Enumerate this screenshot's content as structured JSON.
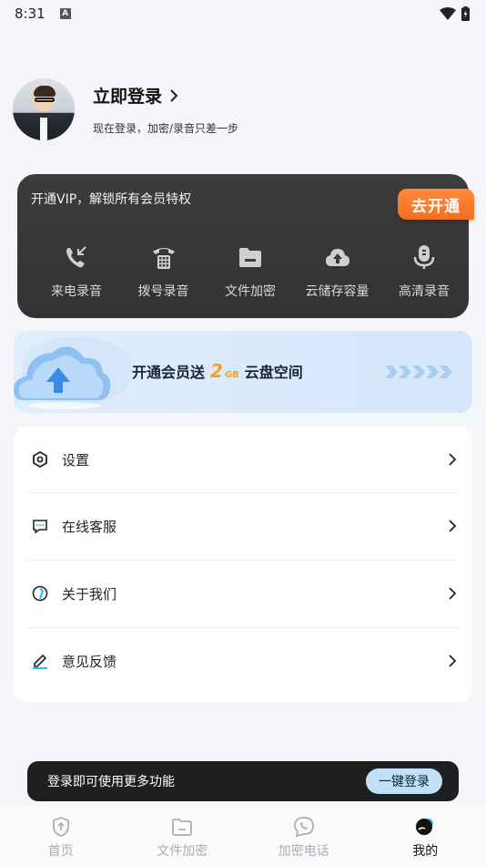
{
  "status_bar": {
    "time": "8:31",
    "notification_badge": "A"
  },
  "profile": {
    "title": "立即登录",
    "subtitle": "现在登录，加密/录音只差一步"
  },
  "vip": {
    "title": "开通VIP，解锁所有会员特权",
    "open_button": "去开通",
    "features": [
      {
        "label": "来电录音",
        "icon": "incoming-call-icon"
      },
      {
        "label": "拨号录音",
        "icon": "phone-dial-icon"
      },
      {
        "label": "文件加密",
        "icon": "folder-icon"
      },
      {
        "label": "云储存容量",
        "icon": "cloud-upload-icon"
      },
      {
        "label": "高清录音",
        "icon": "microphone-icon"
      }
    ]
  },
  "banner": {
    "text_before": "开通会员送",
    "amount": "2",
    "unit": "GB",
    "text_after": "云盘空间"
  },
  "menu": {
    "items": [
      {
        "label": "设置",
        "icon": "settings-icon"
      },
      {
        "label": "在线客服",
        "icon": "chat-icon"
      },
      {
        "label": "关于我们",
        "icon": "info-icon"
      },
      {
        "label": "意见反馈",
        "icon": "edit-icon"
      }
    ]
  },
  "toast": {
    "text": "登录即可使用更多功能",
    "button": "一键登录"
  },
  "bottom_nav": {
    "items": [
      {
        "label": "首页",
        "icon": "shield-icon"
      },
      {
        "label": "文件加密",
        "icon": "folder-icon"
      },
      {
        "label": "加密电话",
        "icon": "phone-bubble-icon"
      },
      {
        "label": "我的",
        "icon": "profile-icon"
      }
    ],
    "active_index": 3
  },
  "colors": {
    "accent_orange": "#f2701f",
    "gold": "#f7a21b",
    "toast_button": "#bfe0f7"
  }
}
